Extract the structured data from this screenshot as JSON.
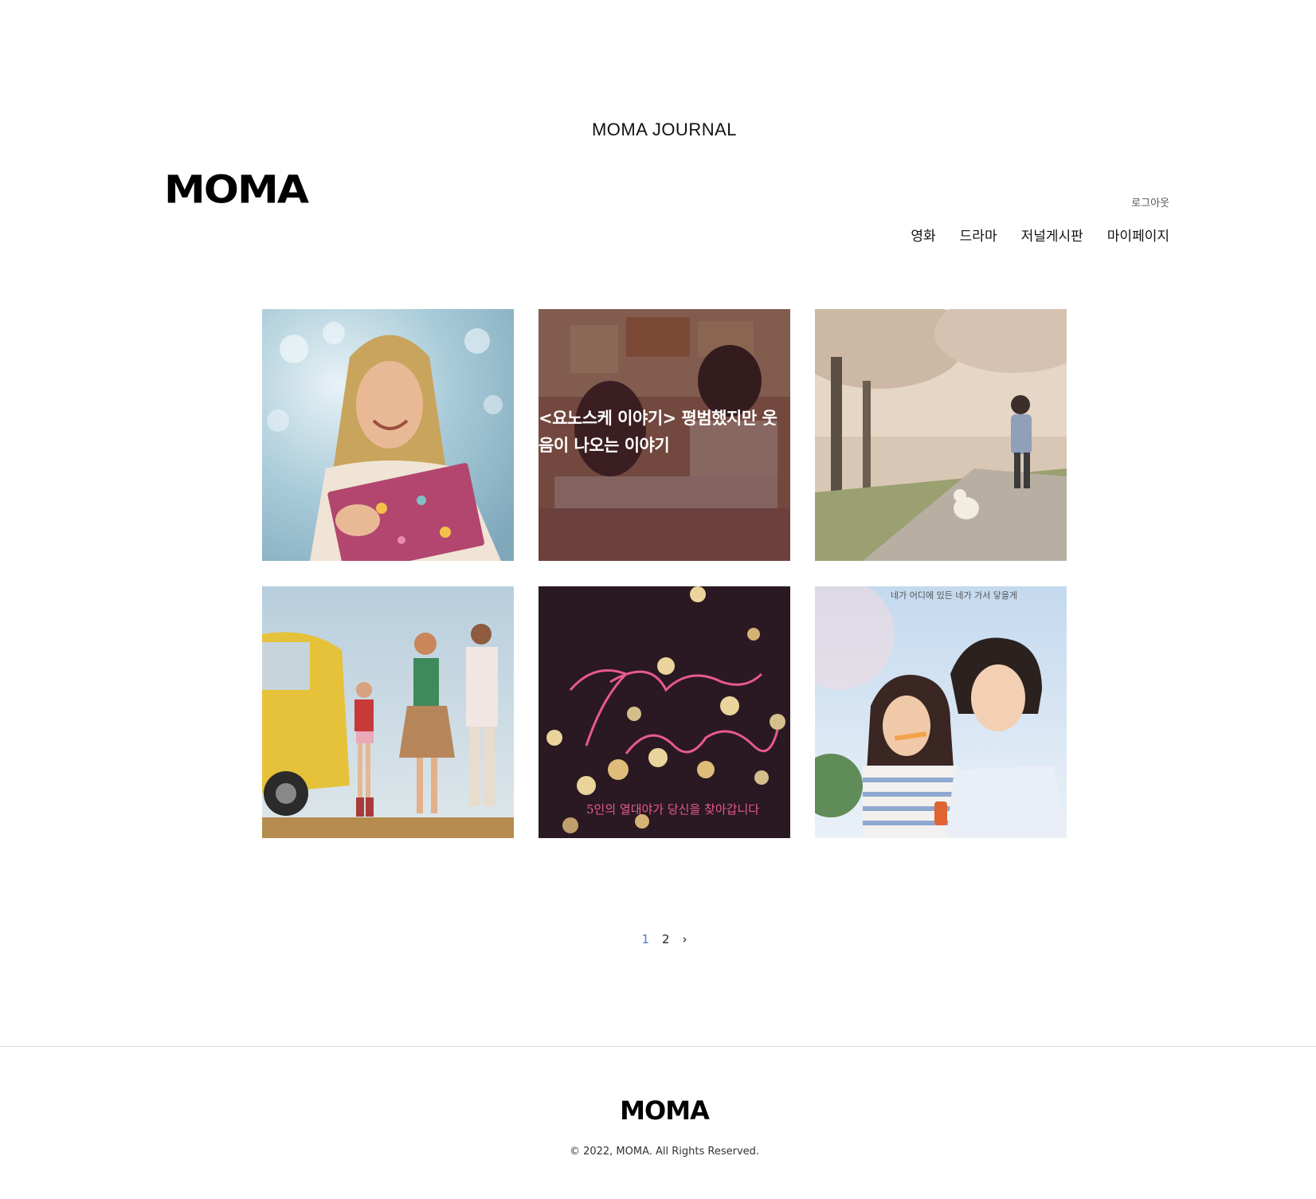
{
  "header": {
    "page_heading": "MOMA JOURNAL",
    "logo_text": "MOMA",
    "logout_label": "로그아웃",
    "nav": [
      {
        "label": "영화"
      },
      {
        "label": "드라마"
      },
      {
        "label": "저널게시판"
      },
      {
        "label": "마이페이지"
      }
    ]
  },
  "grid": {
    "items": [
      {
        "image": "woman-holding-diary-photo",
        "title": ""
      },
      {
        "image": "diner-scene-photo",
        "title": "<요노스케 이야기> 평범했지만 웃음이 나오는 이야기"
      },
      {
        "image": "girl-and-dog-cherry-blossom-photo",
        "title": ""
      },
      {
        "image": "family-yellow-van-photo",
        "title": ""
      },
      {
        "image": "bokeh-lights-poster",
        "title": "",
        "poster_caption": "5인의 열대야가 당신을 찾아갑니다"
      },
      {
        "image": "couple-poster",
        "title": "",
        "poster_caption": "네가 어디에 있든 네가 가서 닿을게"
      }
    ]
  },
  "pagination": {
    "pages": [
      "1",
      "2"
    ],
    "current": "1",
    "next_icon": "chevron-right-icon",
    "next_label": "›"
  },
  "footer": {
    "logo_text": "MOMA",
    "copyright": "© 2022, MOMA. All Rights Reserved."
  },
  "colors": {
    "current_page": "#4a7fc1",
    "divider": "#dddddd"
  }
}
